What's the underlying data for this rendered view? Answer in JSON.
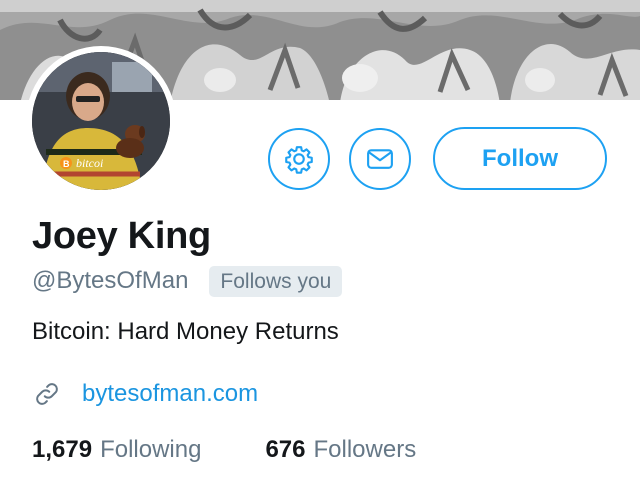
{
  "profile": {
    "display_name": "Joey King",
    "handle": "@BytesOfMan",
    "follows_you_badge": "Follows you",
    "bio": "Bitcoin: Hard Money Returns",
    "website": "bytesofman.com"
  },
  "actions": {
    "settings_icon": "gear-icon",
    "message_icon": "envelope-icon",
    "follow_label": "Follow"
  },
  "stats": {
    "following_count": "1,679",
    "following_label": "Following",
    "followers_count": "676",
    "followers_label": "Followers"
  },
  "avatar": {
    "sweater_text": "bitcoi"
  },
  "colors": {
    "accent": "#1da1f2",
    "link": "#1b95e0",
    "primary_text": "#14171a",
    "secondary_text": "#657786",
    "badge_bg": "#e6ecf0"
  },
  "icons": {
    "link": "link-icon"
  }
}
